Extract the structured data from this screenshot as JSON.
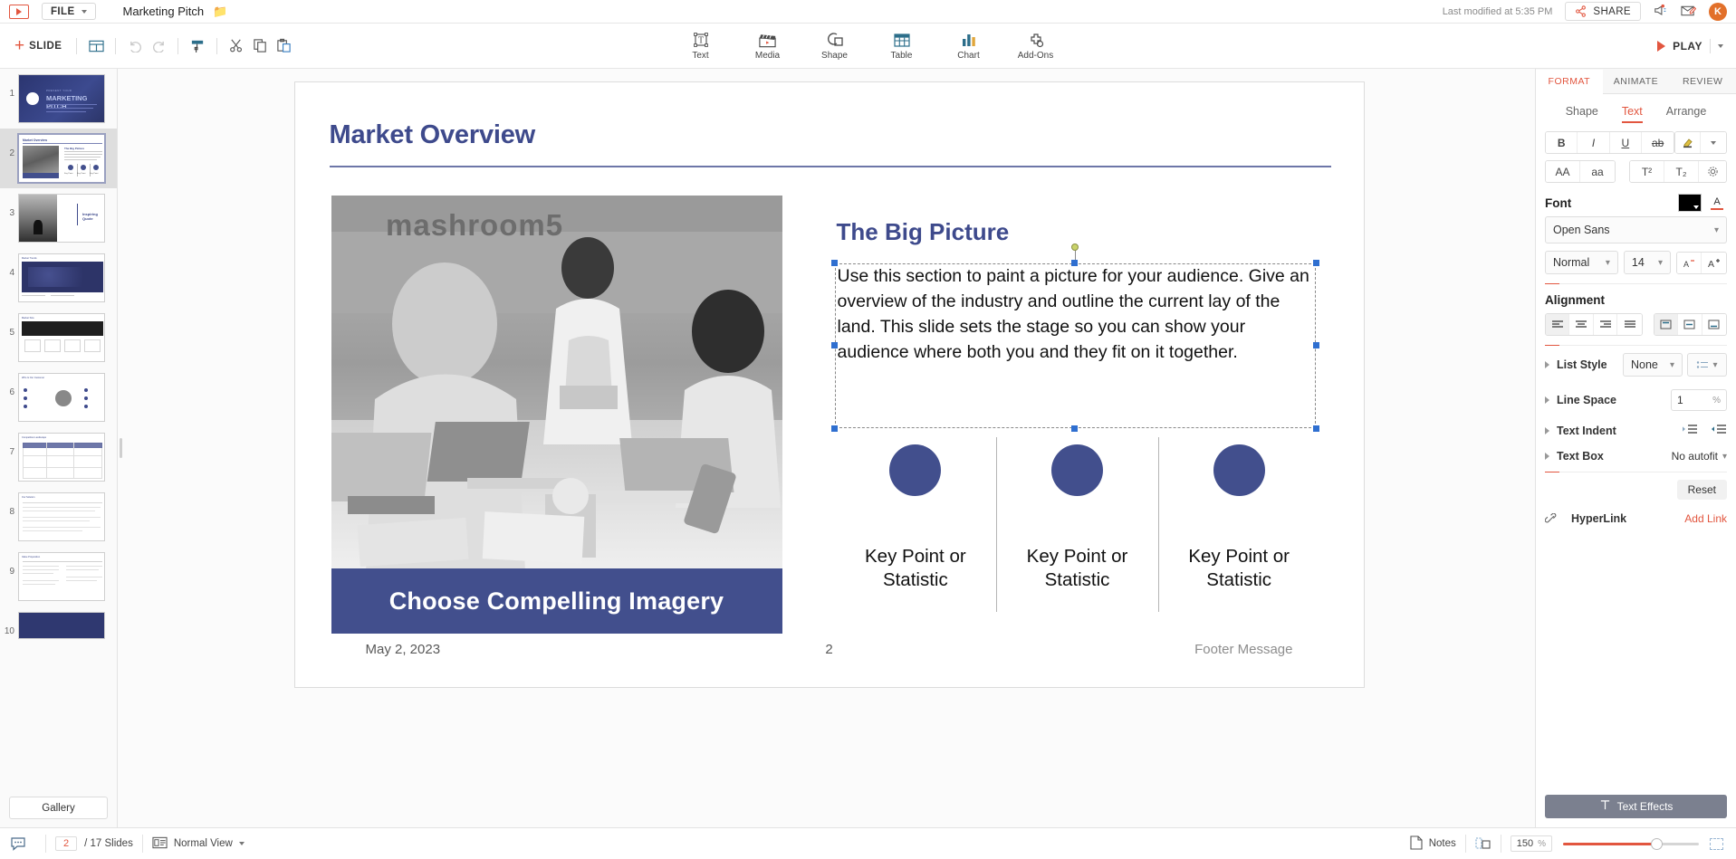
{
  "header": {
    "app_logo": "presentation-logo",
    "file_menu": "FILE",
    "doc_title": "Marketing Pitch",
    "folder_icon": "folder-icon",
    "last_modified": "Last modified at 5:35 PM",
    "share_label": "SHARE",
    "announce_icon": "megaphone-icon",
    "mail_icon": "mail-edit-icon",
    "avatar_initial": "K"
  },
  "toolbar": {
    "slide_label": "SLIDE",
    "layout_icon": "layout-icon",
    "undo_icon": "undo-icon",
    "redo_icon": "redo-icon",
    "paint_icon": "format-painter-icon",
    "cut_icon": "scissors-icon",
    "copy_icon": "copy-icon",
    "paste_icon": "paste-icon",
    "insert_tools": [
      {
        "label": "Text",
        "icon": "text-box-icon"
      },
      {
        "label": "Media",
        "icon": "clapperboard-icon"
      },
      {
        "label": "Shape",
        "icon": "shape-icon"
      },
      {
        "label": "Table",
        "icon": "table-icon"
      },
      {
        "label": "Chart",
        "icon": "bar-chart-icon"
      },
      {
        "label": "Add-Ons",
        "icon": "addons-icon"
      }
    ],
    "play_label": "PLAY"
  },
  "sidebar": {
    "gallery_label": "Gallery",
    "slides": [
      {
        "num": "1",
        "kind": "title",
        "selected": false
      },
      {
        "num": "2",
        "kind": "overview",
        "selected": true
      },
      {
        "num": "3",
        "kind": "quote",
        "selected": false
      },
      {
        "num": "4",
        "kind": "dark-map",
        "selected": false
      },
      {
        "num": "5",
        "kind": "chart",
        "selected": false
      },
      {
        "num": "6",
        "kind": "team",
        "selected": false
      },
      {
        "num": "7",
        "kind": "table",
        "selected": false
      },
      {
        "num": "8",
        "kind": "text",
        "selected": false
      },
      {
        "num": "9",
        "kind": "twocol",
        "selected": false
      },
      {
        "num": "10",
        "kind": "dark",
        "selected": false
      }
    ]
  },
  "slide": {
    "title": "Market Overview",
    "image_caption": "Choose Compelling Imagery",
    "image_overlay_text": "mashroom5",
    "subtitle": "The Big Picture",
    "body_text": "Use this section to paint a picture for your audience. Give an overview of the industry and outline the current lay of the land. This slide sets the stage so you can show your audience where both you and they fit on it together.",
    "key_points": [
      "Key Point or Statistic",
      "Key Point or Statistic",
      "Key Point or Statistic"
    ],
    "date": "May 2, 2023",
    "page_number": "2",
    "footer": "Footer Message",
    "accent_color": "#424f8d",
    "title_color": "#3e4a8c"
  },
  "right_panel": {
    "tabs": [
      {
        "label": "FORMAT",
        "active": true
      },
      {
        "label": "ANIMATE",
        "active": false
      },
      {
        "label": "REVIEW",
        "active": false
      }
    ],
    "subtabs": [
      {
        "label": "Shape",
        "active": false
      },
      {
        "label": "Text",
        "active": true
      },
      {
        "label": "Arrange",
        "active": false
      }
    ],
    "style_buttons": [
      {
        "icon": "bold-icon",
        "label": "B"
      },
      {
        "icon": "italic-icon",
        "label": "I"
      },
      {
        "icon": "underline-icon",
        "label": "U"
      },
      {
        "icon": "strikethrough-icon",
        "label": "ab"
      }
    ],
    "highlight_icon": "highlighter-icon",
    "highlight_caret": "chevron-down-icon",
    "case_buttons": [
      {
        "icon": "uppercase-icon",
        "label": "AA"
      },
      {
        "icon": "lowercase-icon",
        "label": "aa"
      },
      {
        "icon": "superscript-icon",
        "label": "T²"
      },
      {
        "icon": "subscript-icon",
        "label": "T₂"
      }
    ],
    "settings_icon": "gear-icon",
    "font_section_label": "Font",
    "font_color_swatch": "#000000",
    "font_color_icon": "font-color-icon",
    "font_family": "Open Sans",
    "font_weight": "Normal",
    "font_size": "14",
    "font_decrease_icon": "decrease-font-icon",
    "font_increase_icon": "increase-font-icon",
    "alignment_label": "Alignment",
    "align_buttons": [
      {
        "icon": "align-left-icon",
        "active": true
      },
      {
        "icon": "align-center-icon",
        "active": false
      },
      {
        "icon": "align-right-icon",
        "active": false
      },
      {
        "icon": "align-justify-icon",
        "active": false
      }
    ],
    "valign_buttons": [
      {
        "icon": "valign-top-icon",
        "active": true
      },
      {
        "icon": "valign-middle-icon",
        "active": false
      },
      {
        "icon": "valign-bottom-icon",
        "active": false
      }
    ],
    "list_style_label": "List Style",
    "list_style_value": "None",
    "list_style_icon": "bullet-list-icon",
    "line_space_label": "Line Space",
    "line_space_value": "1",
    "line_space_unit": "%",
    "text_indent_label": "Text Indent",
    "indent_decrease_icon": "indent-decrease-icon",
    "indent_increase_icon": "indent-increase-icon",
    "text_box_label": "Text Box",
    "text_box_value": "No autofit",
    "reset_label": "Reset",
    "hyperlink_label": "HyperLink",
    "hyperlink_icon": "link-icon",
    "add_link_label": "Add Link",
    "text_effects_label": "Text Effects",
    "text_effects_icon": "text-effects-icon"
  },
  "status_bar": {
    "comment_icon": "comment-icon",
    "current_slide": "2",
    "slide_count": "/ 17 Slides",
    "view_icon": "normal-view-icon",
    "view_label": "Normal View",
    "notes_icon": "notes-icon",
    "notes_label": "Notes",
    "presenter_icon": "presenter-view-icon",
    "zoom_value": "150",
    "zoom_unit": "%",
    "fit_icon": "fit-to-screen-icon"
  }
}
